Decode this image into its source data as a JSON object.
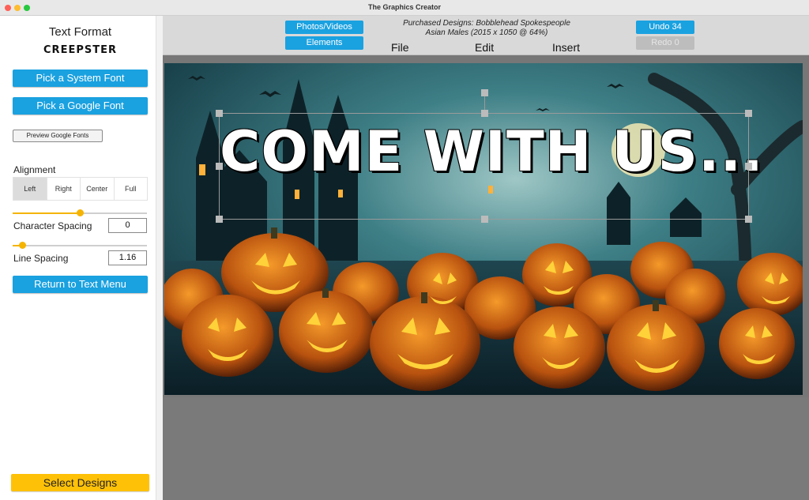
{
  "window": {
    "title": "The Graphics Creator"
  },
  "sidebar": {
    "title": "Text Format",
    "font_name": "CREEPSTER",
    "pick_system_font": "Pick a System Font",
    "pick_google_font": "Pick a Google Font",
    "preview_google_fonts": "Preview Google Fonts",
    "alignment_label": "Alignment",
    "alignment_options": [
      "Left",
      "Right",
      "Center",
      "Full"
    ],
    "alignment_selected": "Left",
    "character_spacing_label": "Character Spacing",
    "character_spacing_value": "0",
    "character_spacing_slider": 0.5,
    "line_spacing_label": "Line Spacing",
    "line_spacing_value": "1.16",
    "line_spacing_slider": 0.07,
    "return_button": "Return to Text Menu",
    "select_designs": "Select Designs"
  },
  "toolbar": {
    "photos_videos": "Photos/Videos",
    "elements": "Elements",
    "design_info_line1": "Purchased Designs: Bobblehead Spokespeople",
    "design_info_line2": "Asian Males  (2015 x 1050 @ 64%)",
    "menu": {
      "file": "File",
      "edit": "Edit",
      "insert": "Insert"
    },
    "undo": "Undo 34",
    "redo": "Redo 0"
  },
  "canvas": {
    "headline": "COME WITH US...",
    "theme_colors": {
      "sky": "#1f5a66",
      "pumpkin": "#d9731a",
      "glow": "#ffd23a",
      "text": "#ffffff"
    }
  },
  "colors": {
    "accent_blue": "#1aa1e0",
    "accent_yellow": "#ffc107",
    "slider": "#f5b400"
  }
}
